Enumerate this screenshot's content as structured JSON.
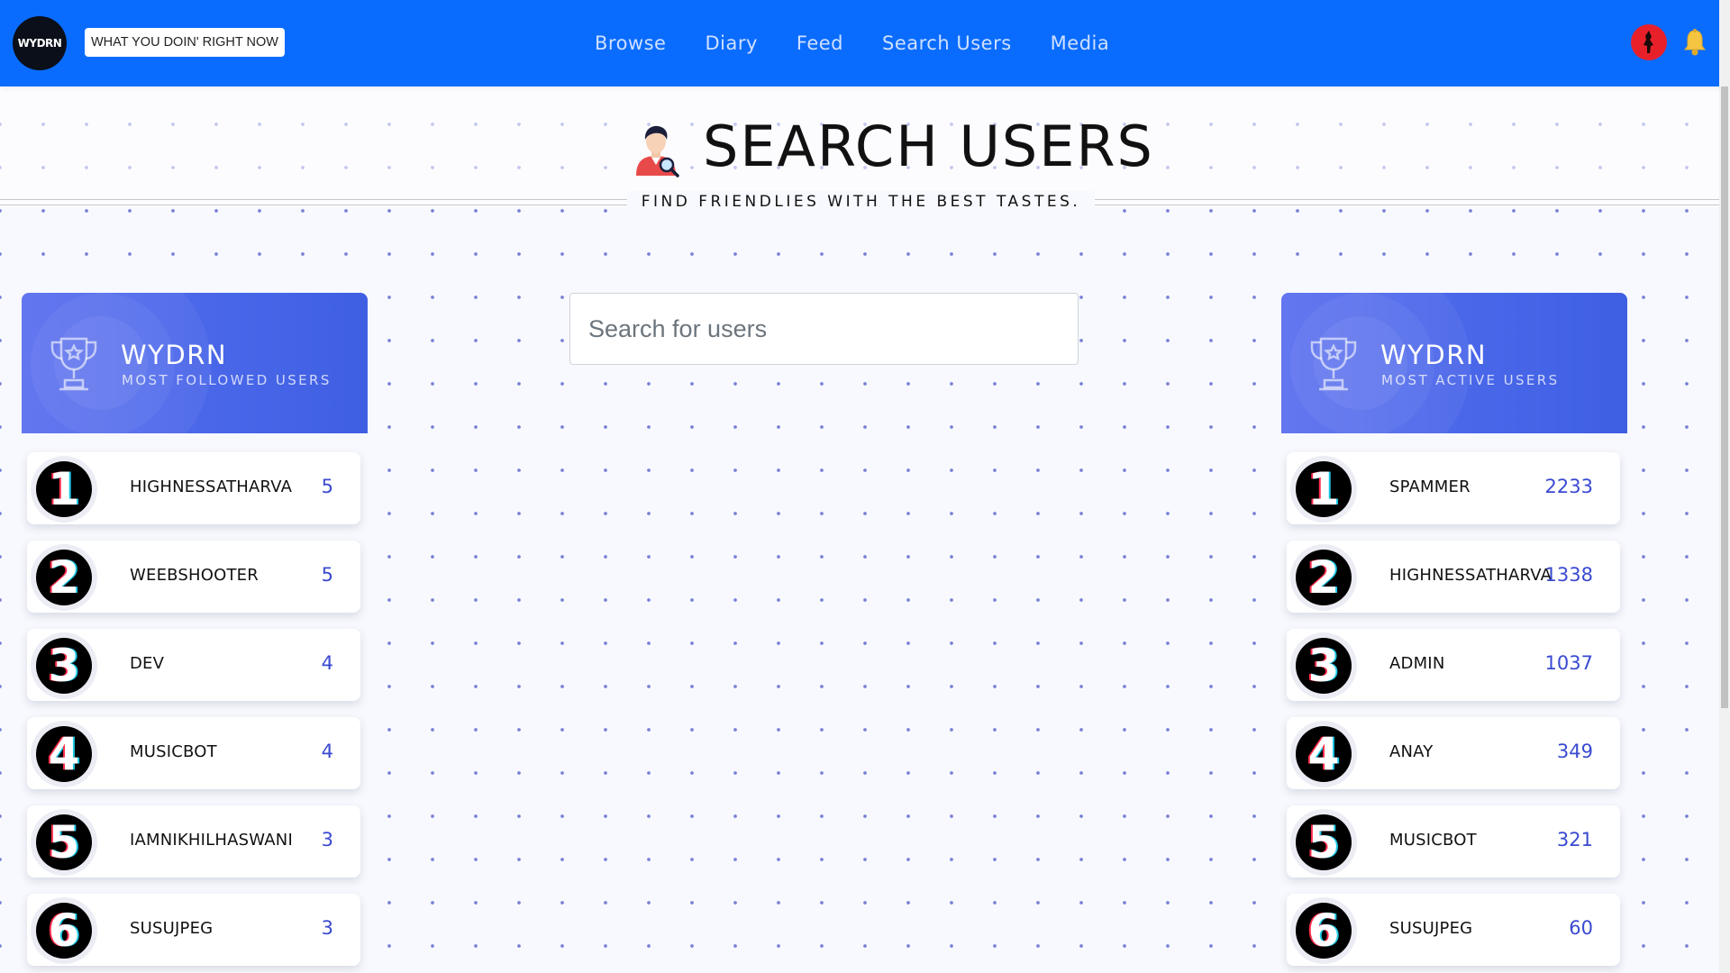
{
  "nav": {
    "logo_text": "WYDRN",
    "status_pill": "WHAT YOU DOIN' RIGHT NOW",
    "links": [
      "Browse",
      "Diary",
      "Feed",
      "Search Users",
      "Media"
    ]
  },
  "header": {
    "title": "SEARCH USERS",
    "subtitle": "FIND FRIENDLIES WITH THE BEST TASTES."
  },
  "search": {
    "placeholder": "Search for users",
    "value": ""
  },
  "boards": {
    "followed": {
      "title": "WYDRN",
      "subtitle": "MOST FOLLOWED USERS",
      "rows": [
        {
          "rank": "1",
          "name": "HIGHNESSATHARVA",
          "value": "5"
        },
        {
          "rank": "2",
          "name": "WEEBSHOOTER",
          "value": "5"
        },
        {
          "rank": "3",
          "name": "DEV",
          "value": "4"
        },
        {
          "rank": "4",
          "name": "MUSICBOT",
          "value": "4"
        },
        {
          "rank": "5",
          "name": "IAMNIKHILHASWANI",
          "value": "3"
        },
        {
          "rank": "6",
          "name": "SUSUJPEG",
          "value": "3"
        }
      ]
    },
    "active": {
      "title": "WYDRN",
      "subtitle": "MOST ACTIVE USERS",
      "rows": [
        {
          "rank": "1",
          "name": "SPAMMER",
          "value": "2233"
        },
        {
          "rank": "2",
          "name": "HIGHNESSATHARVA",
          "value": "1338"
        },
        {
          "rank": "3",
          "name": "ADMIN",
          "value": "1037"
        },
        {
          "rank": "4",
          "name": "ANAY",
          "value": "349"
        },
        {
          "rank": "5",
          "name": "MUSICBOT",
          "value": "321"
        },
        {
          "rank": "6",
          "name": "SUSUJPEG",
          "value": "60"
        }
      ]
    }
  },
  "colors": {
    "navbar": "#0a6cff",
    "board_header": "#4866e8",
    "value_text": "#3a4ad0",
    "avatar": "#e8202a",
    "bell": "#f5c542"
  },
  "icons": {
    "title": "user-search-icon",
    "board": "trophy-icon",
    "notifications": "bell-icon",
    "profile": "avatar"
  }
}
